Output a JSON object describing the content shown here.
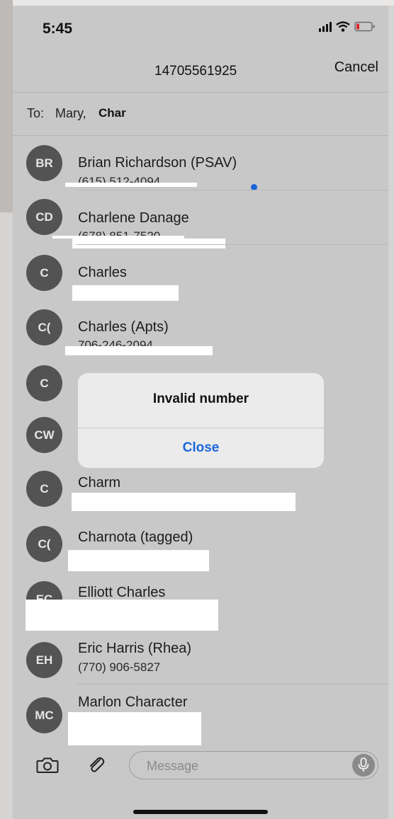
{
  "status": {
    "time": "5:45"
  },
  "nav": {
    "title": "14705561925",
    "cancel_label": "Cancel"
  },
  "to_field": {
    "label": "To:",
    "recipients": "Mary,",
    "typed": "Char"
  },
  "contacts": [
    {
      "initials": "BR",
      "name": "Brian Richardson (PSAV)",
      "detail": "(615) 512-4094"
    },
    {
      "initials": "CD",
      "name": "Charlene Danage",
      "detail": "(678) 851-7520"
    },
    {
      "initials": "C",
      "name": "Charles",
      "detail": ""
    },
    {
      "initials": "C(",
      "name": "Charles (Apts)",
      "detail": "706-246-2094"
    },
    {
      "initials": "C",
      "name": "",
      "detail": ""
    },
    {
      "initials": "CW",
      "name": "",
      "detail": ""
    },
    {
      "initials": "C",
      "name": "Charm",
      "detail": ""
    },
    {
      "initials": "C(",
      "name": "Charnota  (tagged)",
      "detail": ""
    },
    {
      "initials": "EC",
      "name": "Elliott Charles",
      "detail": ""
    },
    {
      "initials": "EH",
      "name": "Eric Harris (Rhea)",
      "detail": "(770) 906-5827"
    },
    {
      "initials": "MC",
      "name": "Marlon Character",
      "detail": ""
    }
  ],
  "alert": {
    "title": "Invalid number",
    "close_label": "Close"
  },
  "compose": {
    "placeholder": "Message"
  },
  "icons": {
    "camera": "camera-icon",
    "attach": "paperclip-icon",
    "mic": "microphone-icon",
    "signal": "signal-icon",
    "wifi": "wifi-icon",
    "battery": "battery-icon"
  },
  "colors": {
    "accent": "#1d67d9",
    "avatar": "#535353",
    "unread_dot": "#1a63d8"
  }
}
